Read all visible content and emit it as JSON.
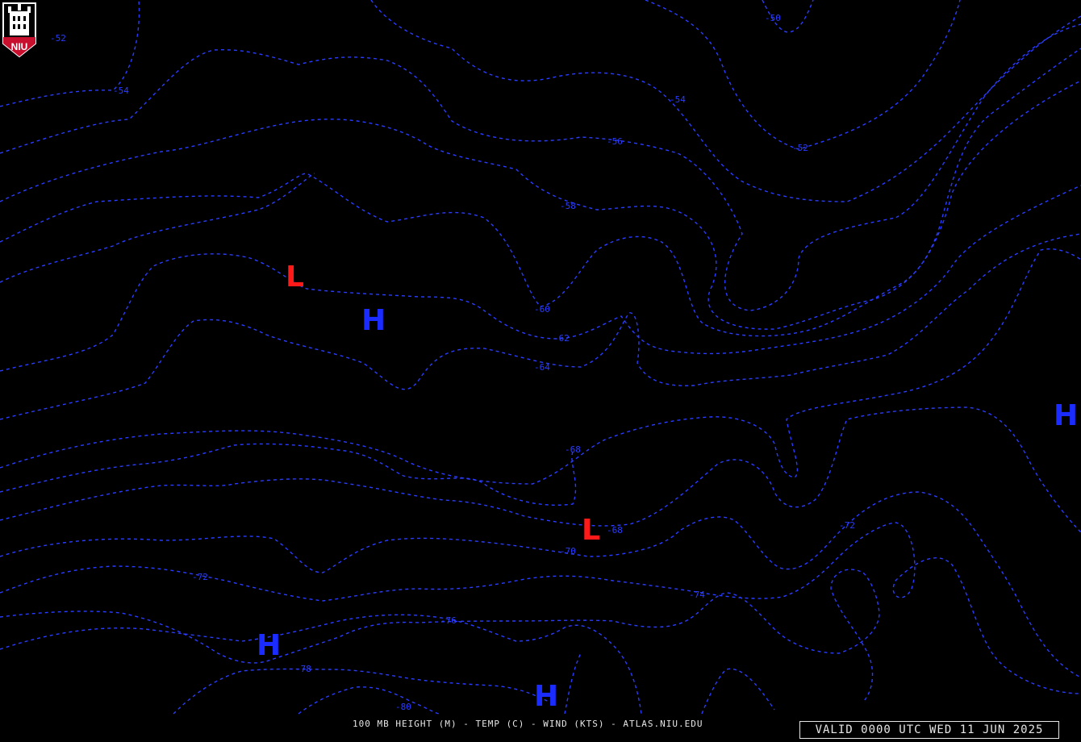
{
  "map": {
    "isotherm_labels": [
      "-50",
      "-52",
      "-52",
      "-54",
      "-54",
      "-56",
      "-58",
      "-60",
      "-62",
      "-64",
      "-68",
      "-68",
      "-70",
      "-72",
      "-72",
      "-74",
      "-76",
      "-78",
      "-80"
    ],
    "pressure_systems": [
      "L",
      "H",
      "H",
      "L",
      "H",
      "H"
    ],
    "colors": {
      "background": "#000000",
      "isotherm": "#2a3cff",
      "high": "#1a2cff",
      "low": "#ff1a1a",
      "text": "#e6e6e6"
    }
  },
  "footer": {
    "caption": "100 MB HEIGHT (M) - TEMP (C) - WIND (KTS) - ATLAS.NIU.EDU",
    "valid_time": "VALID 0000 UTC WED 11 JUN 2025"
  },
  "logo": {
    "text": "NIU",
    "icon": "niu-tower-icon"
  }
}
